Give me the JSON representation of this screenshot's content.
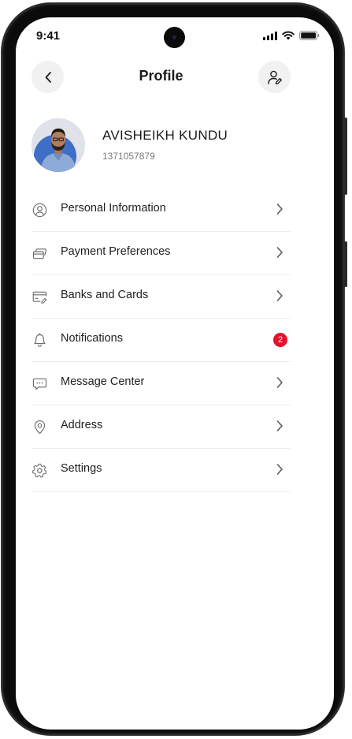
{
  "status_bar": {
    "time": "9:41"
  },
  "header": {
    "title": "Profile",
    "back_icon": "chevron-left-icon",
    "action_icon": "user-edit-icon"
  },
  "profile": {
    "name": "AVISHEIKH KUNDU",
    "phone": "1371057879"
  },
  "menu": {
    "items": [
      {
        "label": "Personal Information",
        "icon": "user-circle-icon"
      },
      {
        "label": "Payment Preferences",
        "icon": "cards-icon"
      },
      {
        "label": "Banks and Cards",
        "icon": "card-edit-icon"
      },
      {
        "label": "Notifications",
        "icon": "bell-icon",
        "badge": "2"
      },
      {
        "label": "Message Center",
        "icon": "message-icon"
      },
      {
        "label": "Address",
        "icon": "location-pin-icon"
      },
      {
        "label": "Settings",
        "icon": "gear-icon"
      }
    ]
  },
  "colors": {
    "badge": "#e8112d",
    "button_bg": "#f1f1f1",
    "text_primary": "#1a1a1a",
    "text_secondary": "#7a7a7a"
  }
}
